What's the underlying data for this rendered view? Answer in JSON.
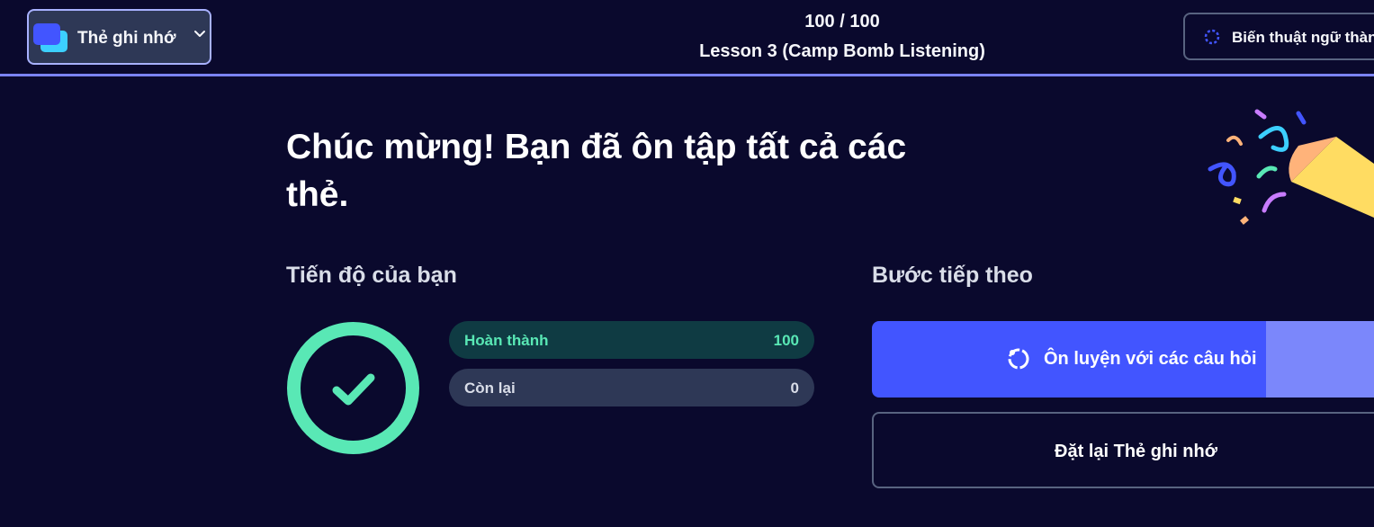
{
  "header": {
    "mode_label": "Thẻ ghi nhớ",
    "progress_count": "100 / 100",
    "set_title": "Lesson 3 (Camp Bomb Listening)",
    "switch_button_label": "Biến thuật ngữ thành"
  },
  "main": {
    "headline": "Chúc mừng! Bạn đã ôn tập tất cả các thẻ.",
    "progress_section_title": "Tiến độ của bạn",
    "next_section_title": "Bước tiếp theo",
    "stats": {
      "completed_label": "Hoàn thành",
      "completed_value": "100",
      "remaining_label": "Còn lại",
      "remaining_value": "0"
    },
    "practice_button_label": "Ôn luyện với các câu hỏi",
    "reset_button_label": "Đặt lại Thẻ ghi nhớ"
  },
  "colors": {
    "background": "#0a092d",
    "accent": "#4255ff",
    "success": "#59e8b5"
  },
  "icons": {
    "mode": "flashcards-icon",
    "chevron": "chevron-down-icon",
    "switch": "loop-icon",
    "check": "check-icon",
    "practice": "learn-loop-icon",
    "celebration": "party-popper-icon"
  }
}
